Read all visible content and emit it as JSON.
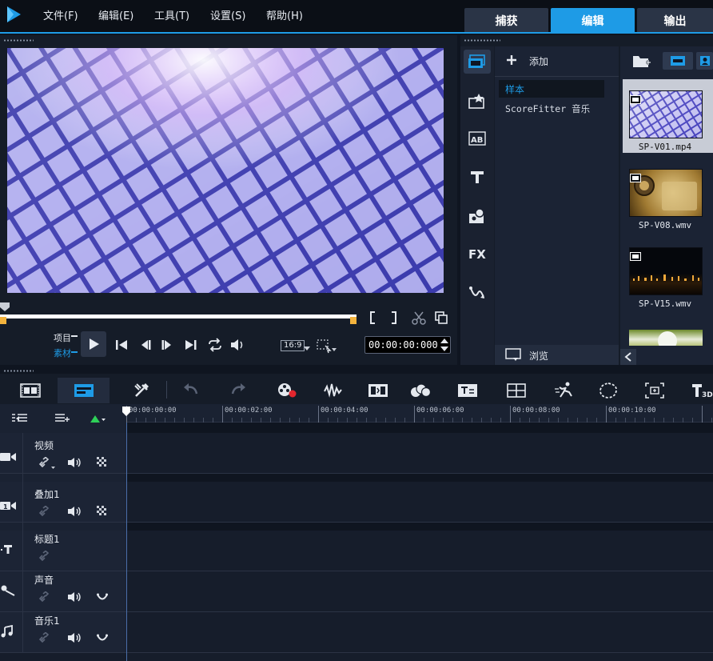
{
  "menu": [
    "文件(F)",
    "编辑(E)",
    "工具(T)",
    "设置(S)",
    "帮助(H)"
  ],
  "mode_tabs": [
    {
      "label": "捕获",
      "active": false
    },
    {
      "label": "编辑",
      "active": true
    },
    {
      "label": "输出",
      "active": false
    }
  ],
  "preview": {
    "mode_project": "项目",
    "mode_clip": "素材",
    "aspect_ratio": "16:9",
    "timecode": "00:00:00:000"
  },
  "library": {
    "add_label": "添加",
    "categories": [
      {
        "label": "样本",
        "selected": true
      },
      {
        "label": "ScoreFitter 音乐",
        "selected": false
      }
    ],
    "browse_label": "浏览",
    "thumbnails": [
      "SP-V01.mp4",
      "SP-V08.wmv",
      "SP-V15.wmv"
    ]
  },
  "timeline": {
    "ruler_ticks": [
      "00:00:00:00",
      "00:00:02:00",
      "00:00:04:00",
      "00:00:06:00",
      "00:00:08:00",
      "00:00:10:00"
    ],
    "tracks": [
      "视频",
      "叠加1",
      "标题1",
      "声音",
      "音乐1"
    ]
  },
  "colors": {
    "accent": "#1e9be6",
    "background": "#0f1520",
    "panel": "#151c28"
  }
}
